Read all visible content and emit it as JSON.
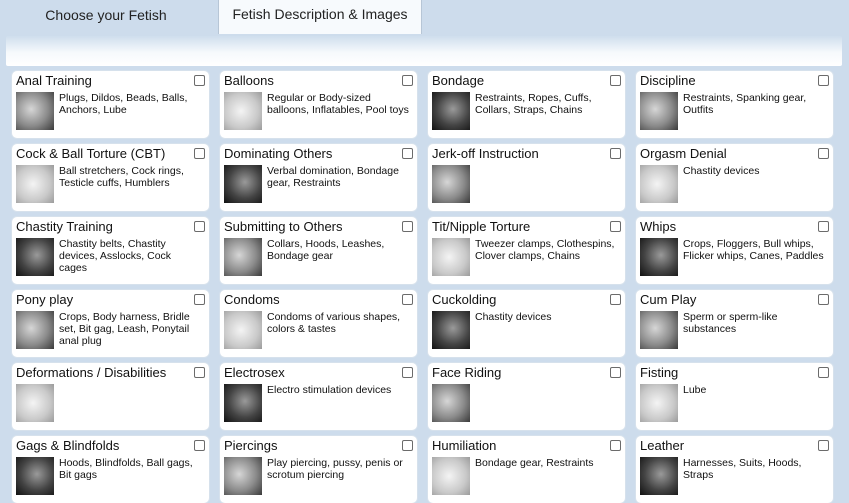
{
  "tabs": [
    {
      "label": "Choose your Fetish",
      "active": false
    },
    {
      "label": "Fetish Description & Images",
      "active": true
    }
  ],
  "cards": [
    {
      "title": "Anal Training",
      "desc": "Plugs, Dildos, Beads, Balls, Anchors, Lube"
    },
    {
      "title": "Balloons",
      "desc": "Regular or Body-sized balloons, Inflatables, Pool toys"
    },
    {
      "title": "Bondage",
      "desc": "Restraints, Ropes, Cuffs, Collars, Straps, Chains"
    },
    {
      "title": "Discipline",
      "desc": "Restraints, Spanking gear, Outfits"
    },
    {
      "title": "Cock & Ball Torture (CBT)",
      "desc": "Ball stretchers, Cock rings, Testicle cuffs, Humblers"
    },
    {
      "title": "Dominating Others",
      "desc": "Verbal domination, Bondage gear, Restraints"
    },
    {
      "title": "Jerk-off Instruction",
      "desc": ""
    },
    {
      "title": "Orgasm Denial",
      "desc": "Chastity devices"
    },
    {
      "title": "Chastity Training",
      "desc": "Chastity belts, Chastity devices, Asslocks, Cock cages"
    },
    {
      "title": "Submitting to Others",
      "desc": "Collars, Hoods, Leashes, Bondage gear"
    },
    {
      "title": "Tit/Nipple Torture",
      "desc": "Tweezer clamps, Clothespins, Clover clamps, Chains"
    },
    {
      "title": "Whips",
      "desc": "Crops, Floggers, Bull whips, Flicker whips, Canes, Paddles"
    },
    {
      "title": "Pony play",
      "desc": "Crops, Body harness, Bridle set, Bit gag, Leash, Ponytail anal plug"
    },
    {
      "title": "Condoms",
      "desc": "Condoms of various shapes, colors & tastes"
    },
    {
      "title": "Cuckolding",
      "desc": "Chastity devices"
    },
    {
      "title": "Cum Play",
      "desc": "Sperm or sperm-like substances"
    },
    {
      "title": "Deformations / Disabilities",
      "desc": ""
    },
    {
      "title": "Electrosex",
      "desc": "Electro stimulation devices"
    },
    {
      "title": "Face Riding",
      "desc": ""
    },
    {
      "title": "Fisting",
      "desc": "Lube"
    },
    {
      "title": "Gags & Blindfolds",
      "desc": "Hoods, Blindfolds, Ball gags, Bit gags"
    },
    {
      "title": "Piercings",
      "desc": "Play piercing, pussy, penis or scrotum piercing"
    },
    {
      "title": "Humiliation",
      "desc": "Bondage gear, Restraints"
    },
    {
      "title": "Leather",
      "desc": "Harnesses, Suits, Hoods, Straps"
    }
  ]
}
